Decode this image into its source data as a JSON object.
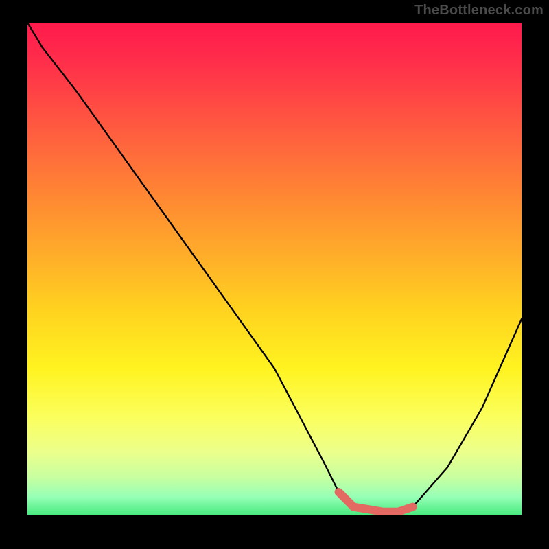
{
  "attribution": "TheBottleneck.com",
  "chart_data": {
    "type": "line",
    "title": "",
    "xlabel": "",
    "ylabel": "",
    "xlim": [
      0,
      100
    ],
    "ylim": [
      0,
      100
    ],
    "series": [
      {
        "name": "curve",
        "x": [
          0,
          3,
          10,
          20,
          30,
          40,
          50,
          60,
          63,
          66,
          72,
          75,
          78,
          85,
          92,
          100
        ],
        "values": [
          100,
          95,
          86,
          72,
          58,
          44,
          30,
          11,
          5,
          2,
          1,
          1,
          2,
          10,
          22,
          40
        ]
      }
    ],
    "highlight": {
      "name": "red-segment",
      "x": [
        63,
        66,
        72,
        75,
        78
      ],
      "values": [
        5,
        2,
        1,
        1,
        2
      ],
      "color": "#e26a62"
    },
    "gradient_stops": [
      {
        "pos": 0.0,
        "color": "#ff1a4d"
      },
      {
        "pos": 0.5,
        "color": "#ffb029"
      },
      {
        "pos": 0.75,
        "color": "#fff320"
      },
      {
        "pos": 1.0,
        "color": "#40e87a"
      }
    ]
  }
}
